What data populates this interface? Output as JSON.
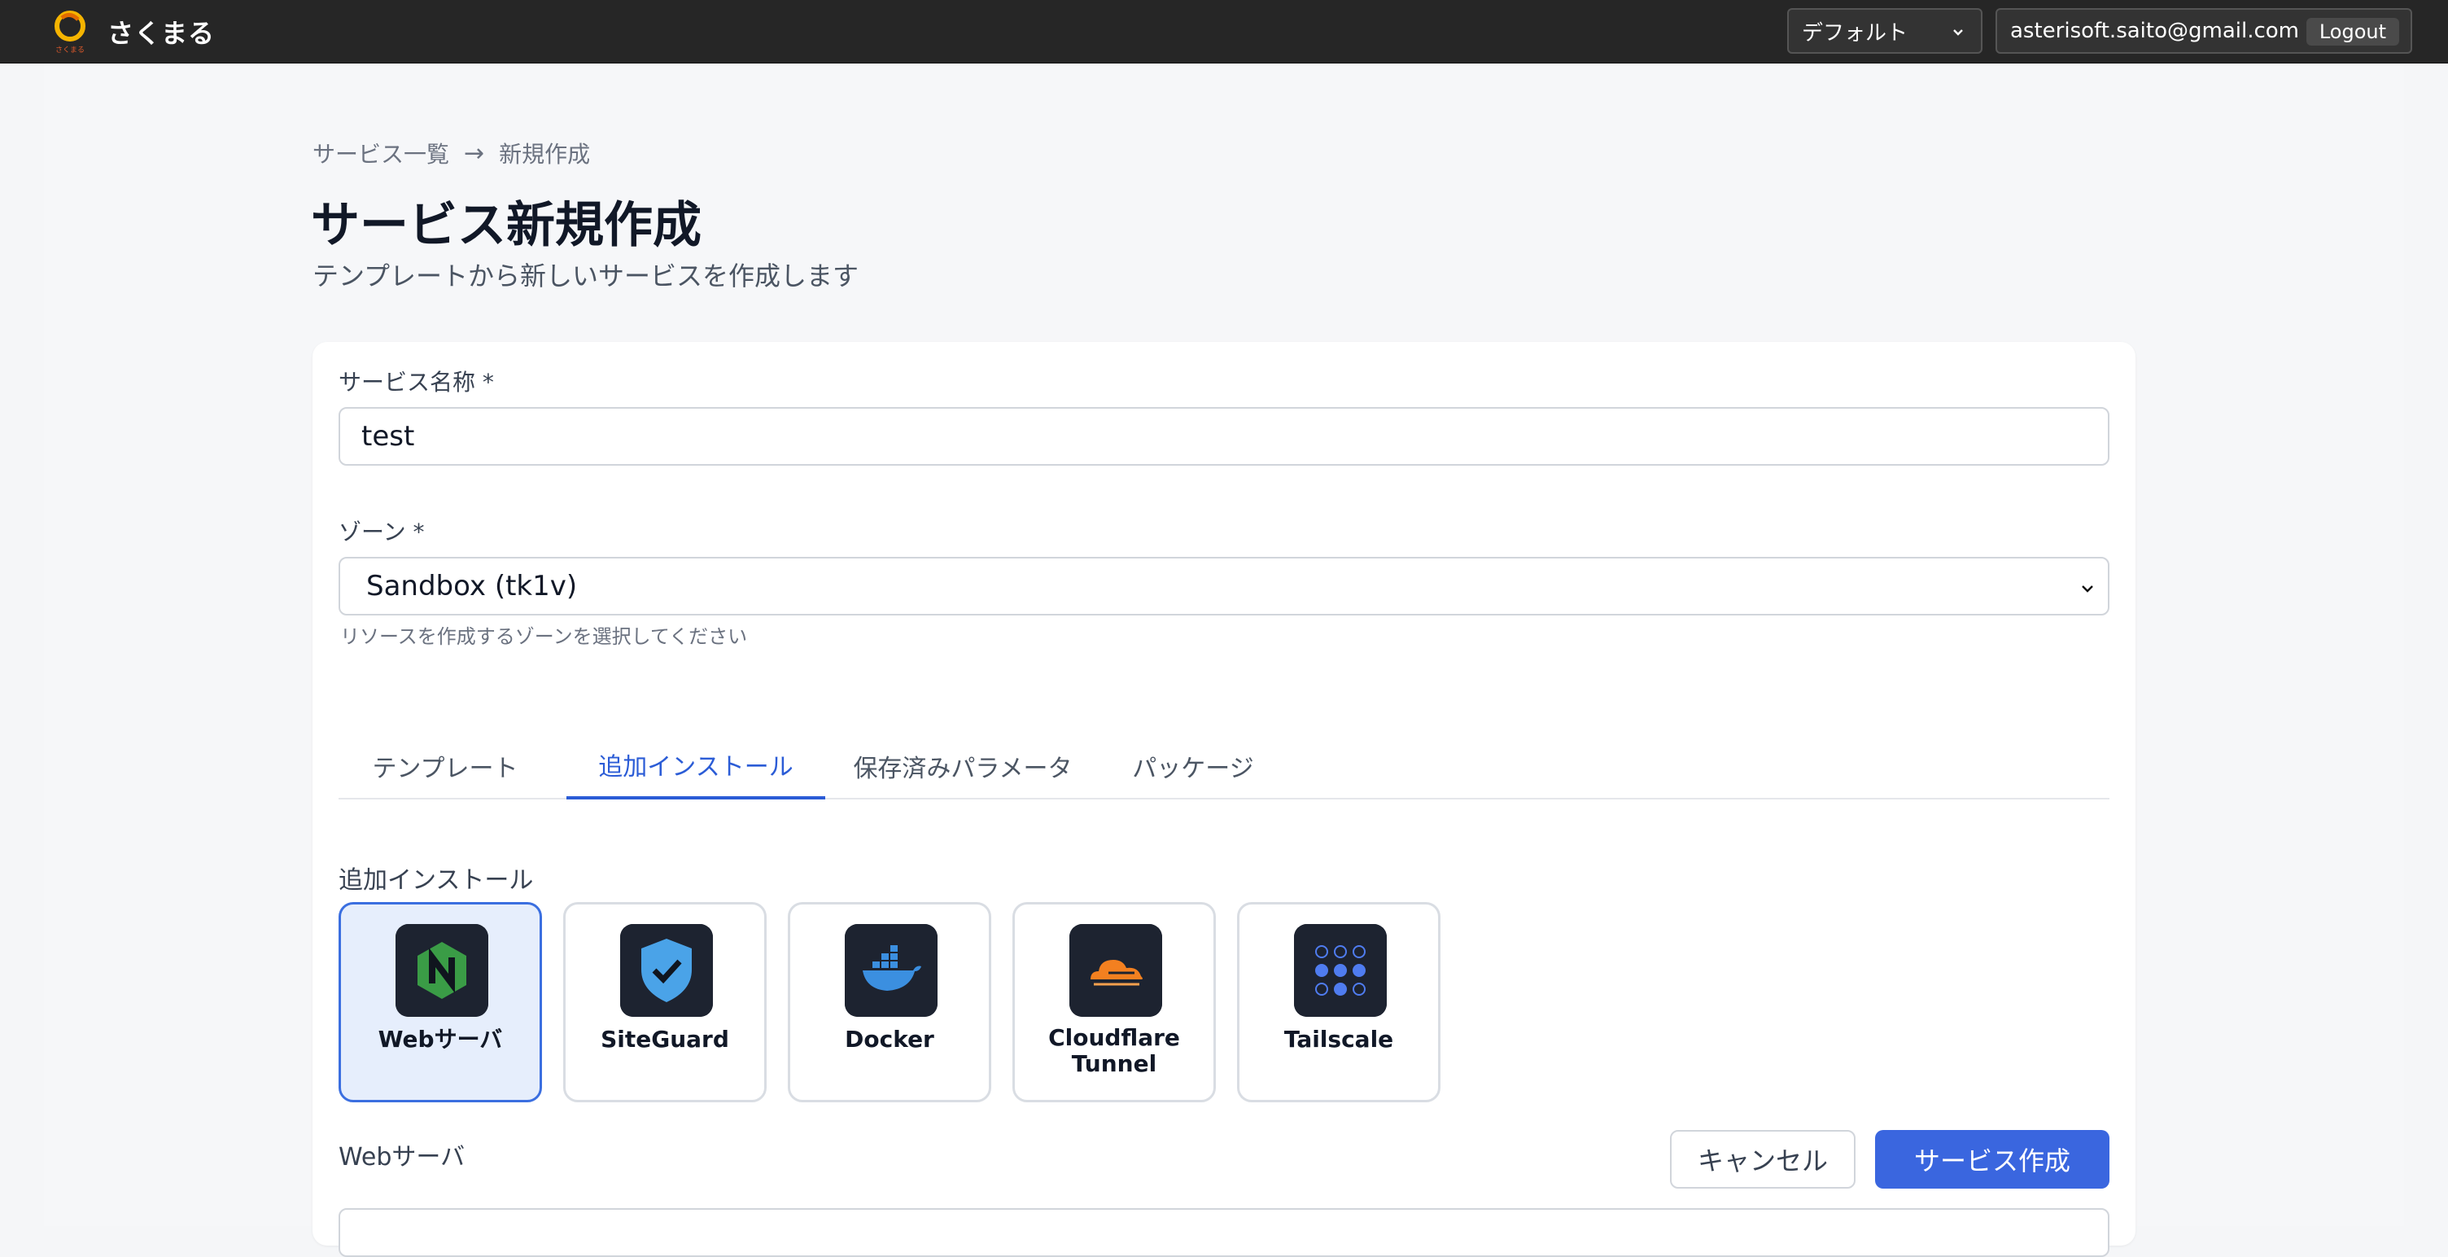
{
  "app": {
    "name": "さくまる"
  },
  "header": {
    "org_select": "デフォルト",
    "user_email": "asterisoft.saito@gmail.com",
    "logout_label": "Logout"
  },
  "breadcrumb": {
    "parent": "サービス一覧",
    "arrow": "→",
    "current": "新規作成"
  },
  "page": {
    "title": "サービス新規作成",
    "subtitle": "テンプレートから新しいサービスを作成します"
  },
  "form": {
    "service_name_label": "サービス名称 *",
    "service_name_value": "test",
    "zone_label": "ゾーン *",
    "zone_value": "Sandbox (tk1v)",
    "zone_help": "リソースを作成するゾーンを選択してください"
  },
  "tabs": [
    {
      "label": "テンプレート",
      "active": false
    },
    {
      "label": "追加インストール",
      "active": true
    },
    {
      "label": "保存済みパラメータ",
      "active": false
    },
    {
      "label": "パッケージ",
      "active": false
    }
  ],
  "install": {
    "section_label": "追加インストール",
    "items": [
      {
        "label": "Webサーバ",
        "icon": "nginx-icon",
        "selected": true
      },
      {
        "label": "SiteGuard",
        "icon": "shield-check-icon",
        "selected": false
      },
      {
        "label": "Docker",
        "icon": "docker-icon",
        "selected": false
      },
      {
        "label": "Cloudflare Tunnel",
        "icon": "cloudflare-icon",
        "selected": false
      },
      {
        "label": "Tailscale",
        "icon": "tailscale-icon",
        "selected": false
      }
    ]
  },
  "web_section": {
    "label": "Webサーバ"
  },
  "actions": {
    "cancel_label": "キャンセル",
    "create_label": "サービス作成"
  },
  "colors": {
    "accent": "#3a66df",
    "topbar": "#262626",
    "selected_bg": "#e6eefc"
  }
}
